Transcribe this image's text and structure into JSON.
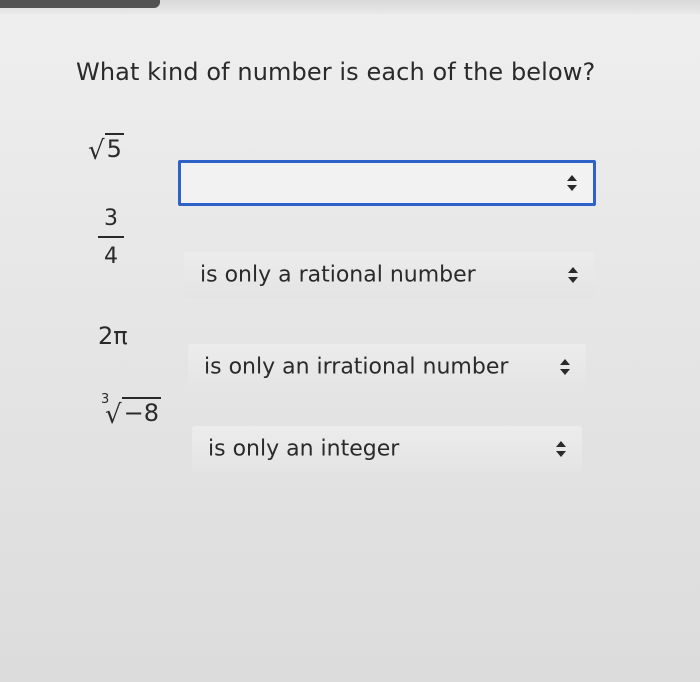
{
  "question": "What kind of number is each of the below?",
  "items": [
    {
      "expr_radicand": "5",
      "selected": ""
    },
    {
      "expr_num": "3",
      "expr_den": "4",
      "selected": "is only a rational number"
    },
    {
      "expr_text": "2π",
      "selected": "is only an irrational number"
    },
    {
      "expr_index": "3",
      "expr_radicand": "−8",
      "selected": "is only an integer"
    }
  ],
  "colors": {
    "focus_border": "#2f62c9"
  },
  "icons": {
    "select_arrows": "updown-arrows-icon"
  }
}
